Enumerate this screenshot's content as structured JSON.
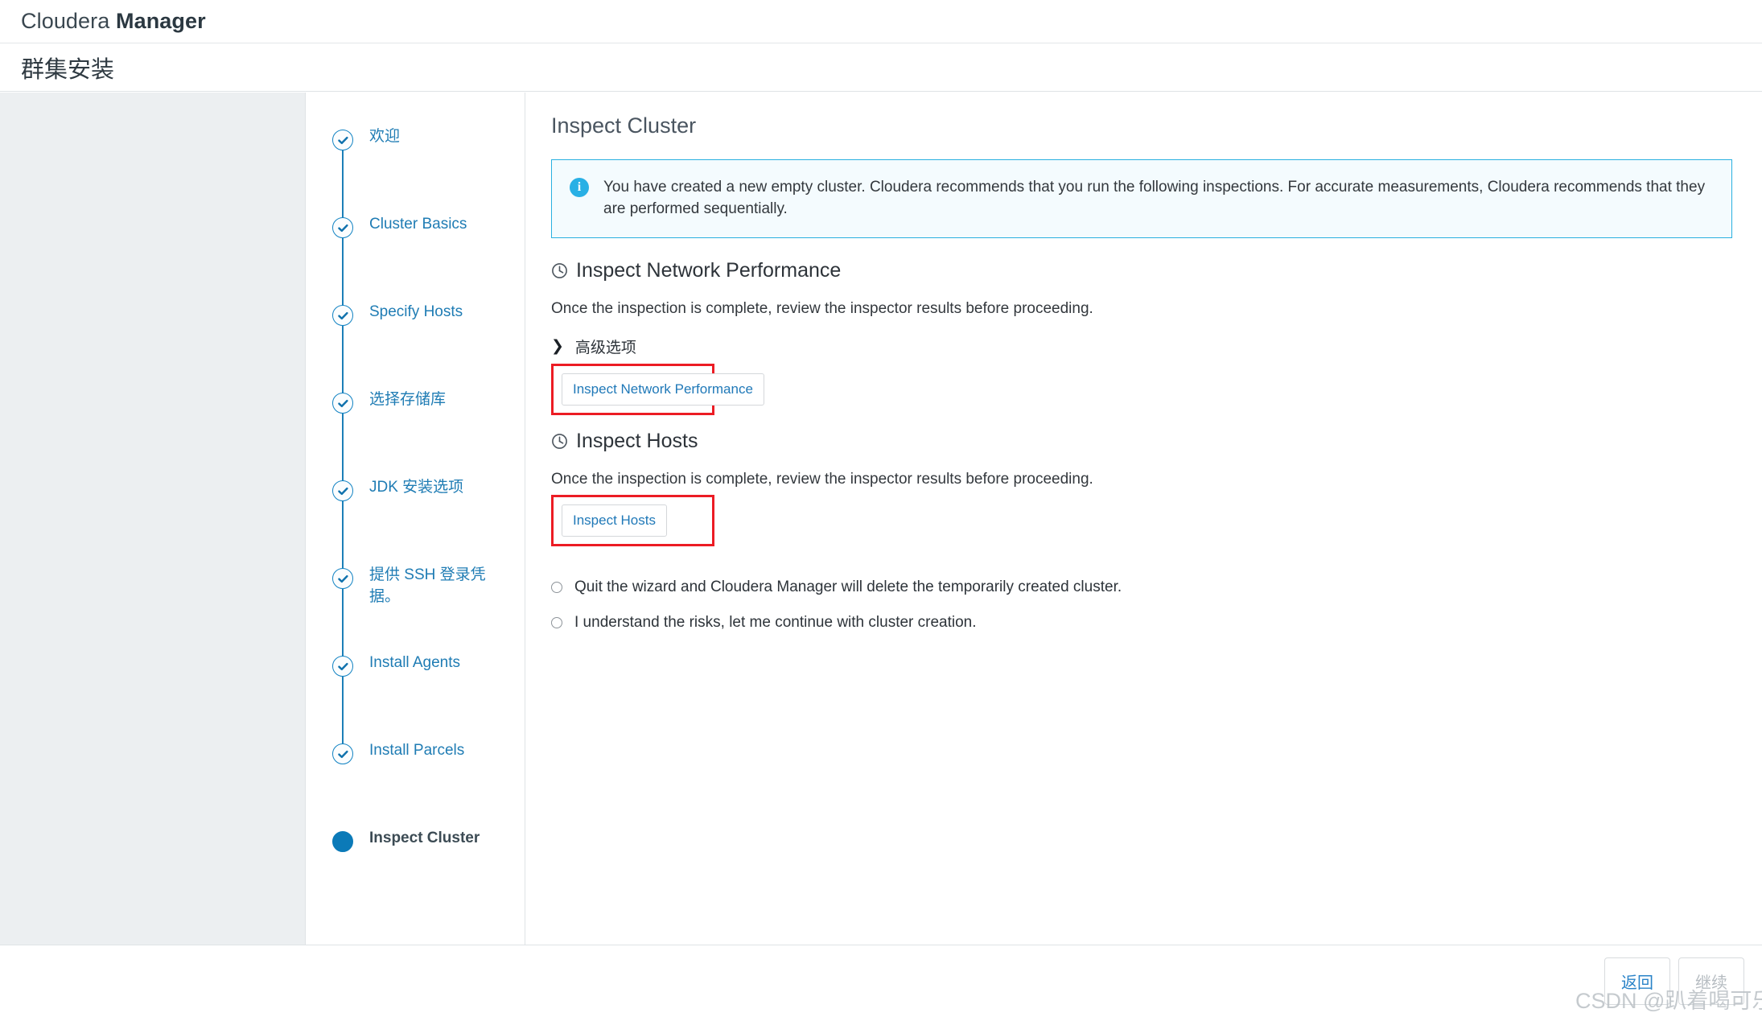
{
  "brand": {
    "name_light": "Cloudera ",
    "name_bold": "Manager"
  },
  "page": {
    "title": "群集安装"
  },
  "wizard": {
    "steps": [
      {
        "label": "欢迎",
        "state": "complete"
      },
      {
        "label": "Cluster Basics",
        "state": "complete"
      },
      {
        "label": "Specify Hosts",
        "state": "complete"
      },
      {
        "label": "选择存储库",
        "state": "complete"
      },
      {
        "label": "JDK 安装选项",
        "state": "complete"
      },
      {
        "label": "提供 SSH 登录凭据。",
        "state": "complete"
      },
      {
        "label": "Install Agents",
        "state": "complete"
      },
      {
        "label": "Install Parcels",
        "state": "complete"
      },
      {
        "label": "Inspect Cluster",
        "state": "current"
      }
    ]
  },
  "main": {
    "heading": "Inspect Cluster",
    "info_banner": {
      "icon": "info-icon",
      "text": "You have created a new empty cluster. Cloudera recommends that you run the following inspections. For accurate measurements, Cloudera recommends that they are performed sequentially."
    },
    "sections": [
      {
        "icon": "clock-icon",
        "title": "Inspect Network Performance",
        "description": "Once the inspection is complete, review the inspector results before proceeding.",
        "advanced_label": "高级选项",
        "advanced_chevron": "❯",
        "button_label": "Inspect Network Performance"
      },
      {
        "icon": "clock-icon",
        "title": "Inspect Hosts",
        "description": "Once the inspection is complete, review the inspector results before proceeding.",
        "button_label": "Inspect Hosts"
      }
    ],
    "radio_options": [
      {
        "label": "Quit the wizard and Cloudera Manager will delete the temporarily created cluster.",
        "selected": false
      },
      {
        "label": "I understand the risks, let me continue with cluster creation.",
        "selected": false
      }
    ]
  },
  "footer": {
    "back_label": "返回",
    "next_label": "继续"
  },
  "watermark": {
    "text": "CSDN @趴着喝可乐"
  },
  "colors": {
    "brand_dark": "#3a4750",
    "step_blue": "#1f7cb4",
    "current_step": "#0b7ab8",
    "info_border": "#2ab0e0",
    "info_bg": "#f4fbfe",
    "annotation_red": "#ec1c24",
    "link_blue": "#2079b8",
    "gutter_gray": "#eceff1"
  }
}
